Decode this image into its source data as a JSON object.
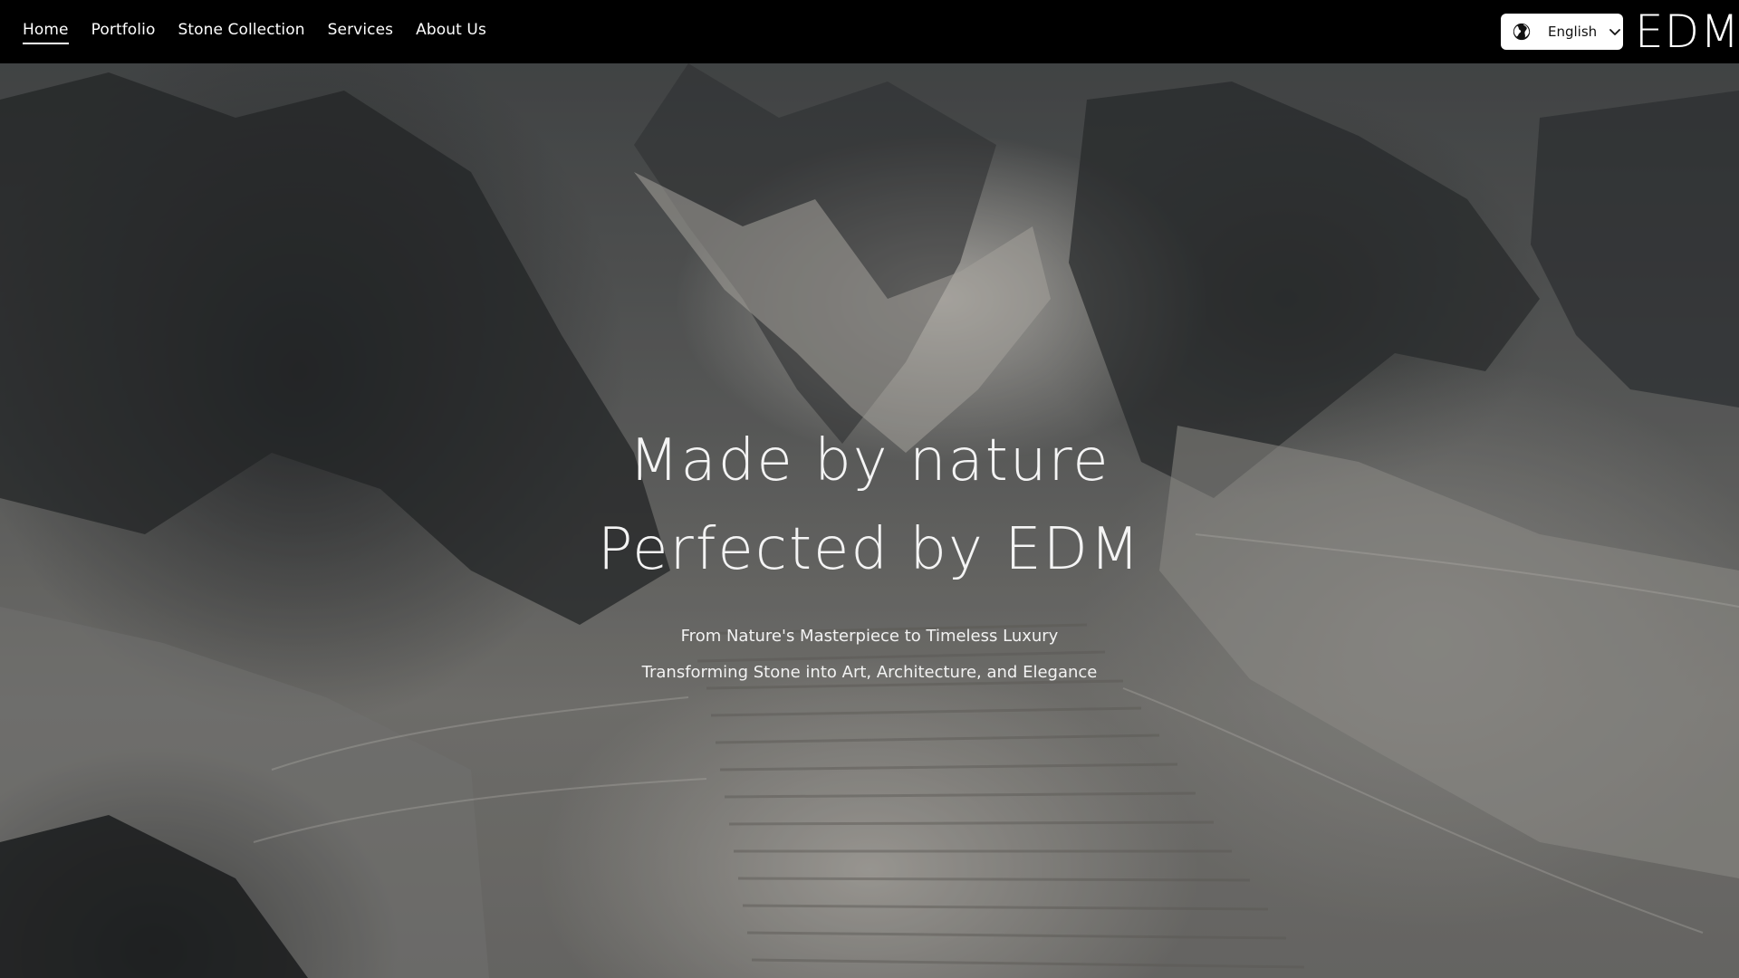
{
  "nav": {
    "items": [
      {
        "label": "Home",
        "active": true
      },
      {
        "label": "Portfolio",
        "active": false
      },
      {
        "label": "Stone Collection",
        "active": false
      },
      {
        "label": "Services",
        "active": false
      },
      {
        "label": "About Us",
        "active": false
      }
    ]
  },
  "language": {
    "selected": "English",
    "icon": "globe-icon",
    "dropdown_icon": "chevron-down-icon"
  },
  "brand": {
    "logo_text": "EDM"
  },
  "hero": {
    "headline_line1": "Made by nature",
    "headline_line2": "Perfected by EDM",
    "subline1": "From Nature's Masterpiece to Timeless Luxury",
    "subline2": "Transforming Stone into Art, Architecture, and Elegance"
  },
  "colors": {
    "topbar": "#000000",
    "text": "#ffffff",
    "selector_bg": "#ffffff"
  }
}
